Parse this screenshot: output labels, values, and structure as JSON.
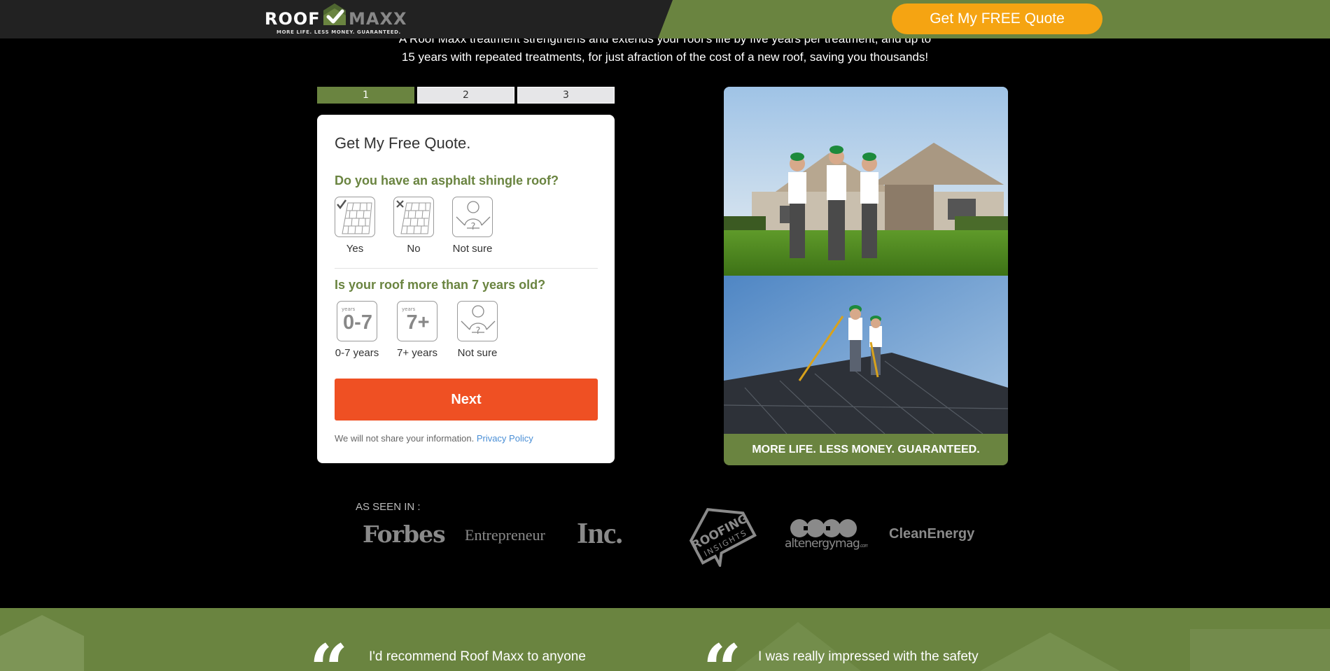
{
  "header": {
    "logo_word_left": "ROOF",
    "logo_word_right": "MAXX",
    "logo_tagline": "MORE LIFE. LESS MONEY. GUARANTEED.",
    "cta_label": "Get My FREE Quote",
    "colors": {
      "dark": "#222222",
      "green": "#6a8440",
      "cta": "#f5a412"
    }
  },
  "intro": {
    "line1": "A Roof Maxx treatment strengthens and extends your roof's life by five years per treatment, and up to",
    "line2": "15 years with repeated treatments, for just afraction of the cost of a new roof, saving you thousands!"
  },
  "steps": [
    "1",
    "2",
    "3"
  ],
  "form": {
    "title": "Get My Free Quote.",
    "q1": {
      "label": "Do you have an asphalt shingle roof?",
      "options": [
        {
          "label": "Yes",
          "icon": "shingle-check-icon"
        },
        {
          "label": "No",
          "icon": "shingle-x-icon"
        },
        {
          "label": "Not sure",
          "icon": "shrug-person-icon"
        }
      ]
    },
    "q2": {
      "label": "Is your roof more than 7 years old?",
      "options": [
        {
          "label": "0-7 years",
          "icon_small": "years",
          "icon_big": "0-7"
        },
        {
          "label": "7+ years",
          "icon_small": "years",
          "icon_big": "7+"
        },
        {
          "label": "Not sure",
          "icon": "shrug-person-icon"
        }
      ]
    },
    "next_label": "Next",
    "privacy_text": "We will not share your information.",
    "privacy_link": "Privacy Policy"
  },
  "photos": {
    "band_text": "MORE LIFE. LESS MONEY. GUARANTEED."
  },
  "press": {
    "label": "AS SEEN IN :",
    "logos": [
      "Forbes",
      "Entrepreneur",
      "Inc.",
      "ROOFING INSIGHTS",
      "altenergymag.com",
      "CleanEnergy"
    ]
  },
  "testimonials": [
    {
      "mark": "“",
      "text": "I'd recommend Roof Maxx to anyone"
    },
    {
      "mark": "“",
      "text": "I was really impressed with the safety"
    }
  ]
}
